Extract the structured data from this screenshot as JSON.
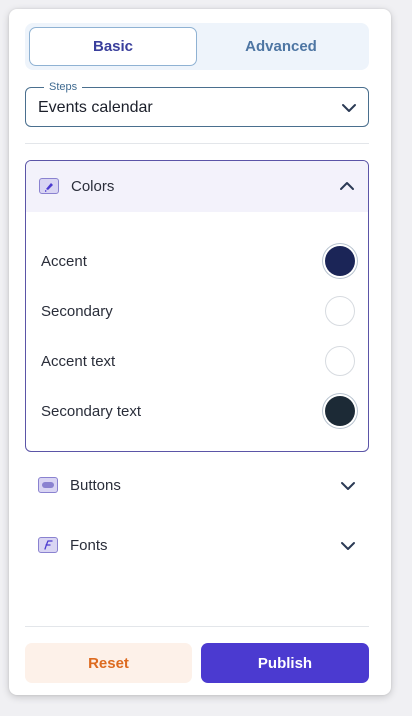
{
  "tabs": {
    "basic": "Basic",
    "advanced": "Advanced"
  },
  "steps": {
    "legend": "Steps",
    "value": "Events calendar"
  },
  "sections": {
    "colors": {
      "label": "Colors",
      "icon": "brush-icon",
      "expanded": true,
      "items": [
        {
          "label": "Accent",
          "color": "#1b2557"
        },
        {
          "label": "Secondary",
          "color": "#ffffff"
        },
        {
          "label": "Accent text",
          "color": "#ffffff"
        },
        {
          "label": "Secondary text",
          "color": "#1c2a36"
        }
      ]
    },
    "buttons": {
      "label": "Buttons",
      "icon": "button-shape-icon",
      "expanded": false
    },
    "fonts": {
      "label": "Fonts",
      "icon": "font-icon",
      "expanded": false
    }
  },
  "actions": {
    "reset": "Reset",
    "publish": "Publish"
  },
  "theme": {
    "accent": "#4b3ad0",
    "reset_text": "#dd6b20",
    "border_accent": "#5b55a7"
  }
}
